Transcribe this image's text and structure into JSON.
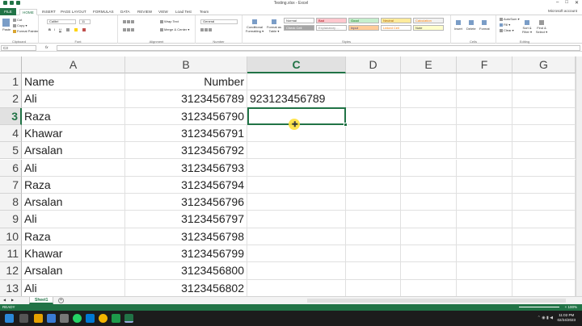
{
  "window": {
    "title": "Testing.xlsx - Excel",
    "account": "Microsoft account",
    "min": "–",
    "max": "□",
    "close": "✕"
  },
  "tabs": {
    "file": "FILE",
    "items": [
      "HOME",
      "INSERT",
      "PAGE LAYOUT",
      "FORMULAS",
      "DATA",
      "REVIEW",
      "VIEW",
      "Load Test",
      "Team"
    ]
  },
  "ribbon": {
    "clipboard": {
      "label": "Clipboard",
      "paste": "Paste",
      "cut": "Cut",
      "copy": "Copy ▾",
      "format_painter": "Format Painter"
    },
    "font": {
      "label": "Font",
      "name": "Calibri",
      "size": "11",
      "bold": "B",
      "italic": "I",
      "underline": "U"
    },
    "alignment": {
      "label": "Alignment",
      "wrap": "Wrap Text",
      "merge": "Merge & Center ▾"
    },
    "number": {
      "label": "Number",
      "format": "General"
    },
    "styles": {
      "label": "Styles",
      "conditional": "Conditional Formatting ▾",
      "format_as_table": "Format as Table ▾",
      "cells": [
        {
          "text": "Normal",
          "bg": "#ffffff",
          "fg": "#333333"
        },
        {
          "text": "Bad",
          "bg": "#ffc7ce",
          "fg": "#9c0006"
        },
        {
          "text": "Good",
          "bg": "#c6efce",
          "fg": "#006100"
        },
        {
          "text": "Neutral",
          "bg": "#ffeb9c",
          "fg": "#9c5700"
        },
        {
          "text": "Calculation",
          "bg": "#f2f2f2",
          "fg": "#fa7d00"
        },
        {
          "text": "Check Cell",
          "bg": "#a5a5a5",
          "fg": "#ffffff"
        },
        {
          "text": "Explanatory ...",
          "bg": "#ffffff",
          "fg": "#7f7f7f"
        },
        {
          "text": "Input",
          "bg": "#ffcc99",
          "fg": "#3f3f76"
        },
        {
          "text": "Linked Cell",
          "bg": "#ffffff",
          "fg": "#fa7d00"
        },
        {
          "text": "Note",
          "bg": "#ffffcc",
          "fg": "#333333"
        }
      ]
    },
    "cells": {
      "label": "Cells",
      "insert": "Insert",
      "delete": "Delete",
      "format": "Format"
    },
    "editing": {
      "label": "Editing",
      "autosum": "AutoSum ▾",
      "fill": "Fill ▾",
      "clear": "Clear ▾",
      "sort": "Sort & Filter ▾",
      "find": "Find & Select ▾"
    }
  },
  "formula_bar": {
    "name_box": "C3",
    "fx": "fx",
    "value": ""
  },
  "columns": [
    "A",
    "B",
    "C",
    "D",
    "E",
    "F",
    "G"
  ],
  "selected_column": "C",
  "selected_row": "3",
  "rows": [
    {
      "n": "1",
      "a": "Name",
      "b": "Number",
      "c": ""
    },
    {
      "n": "2",
      "a": "Ali",
      "b": "3123456789",
      "c": "923123456789"
    },
    {
      "n": "3",
      "a": "Raza",
      "b": "3123456790",
      "c": ""
    },
    {
      "n": "4",
      "a": "Khawar",
      "b": "3123456791",
      "c": ""
    },
    {
      "n": "5",
      "a": "Arsalan",
      "b": "3123456792",
      "c": ""
    },
    {
      "n": "6",
      "a": "Ali",
      "b": "3123456793",
      "c": ""
    },
    {
      "n": "7",
      "a": "Raza",
      "b": "3123456794",
      "c": ""
    },
    {
      "n": "8",
      "a": "Arsalan",
      "b": "3123456796",
      "c": ""
    },
    {
      "n": "9",
      "a": "Ali",
      "b": "3123456797",
      "c": ""
    },
    {
      "n": "10",
      "a": "Raza",
      "b": "3123456798",
      "c": ""
    },
    {
      "n": "11",
      "a": "Khawar",
      "b": "3123456799",
      "c": ""
    },
    {
      "n": "12",
      "a": "Arsalan",
      "b": "3123456800",
      "c": ""
    },
    {
      "n": "13",
      "a": "Ali",
      "b": "3123456802",
      "c": ""
    }
  ],
  "sheet_tabs": [
    "Sheet1"
  ],
  "add_sheet": "+",
  "status": {
    "ready": "READY",
    "zoom": "+ 100%"
  },
  "taskbar": {
    "time": "11:02 PM",
    "date": "02/24/2023"
  },
  "colors": {
    "accent": "#217346",
    "cursor_highlight": "#ffe23d"
  }
}
